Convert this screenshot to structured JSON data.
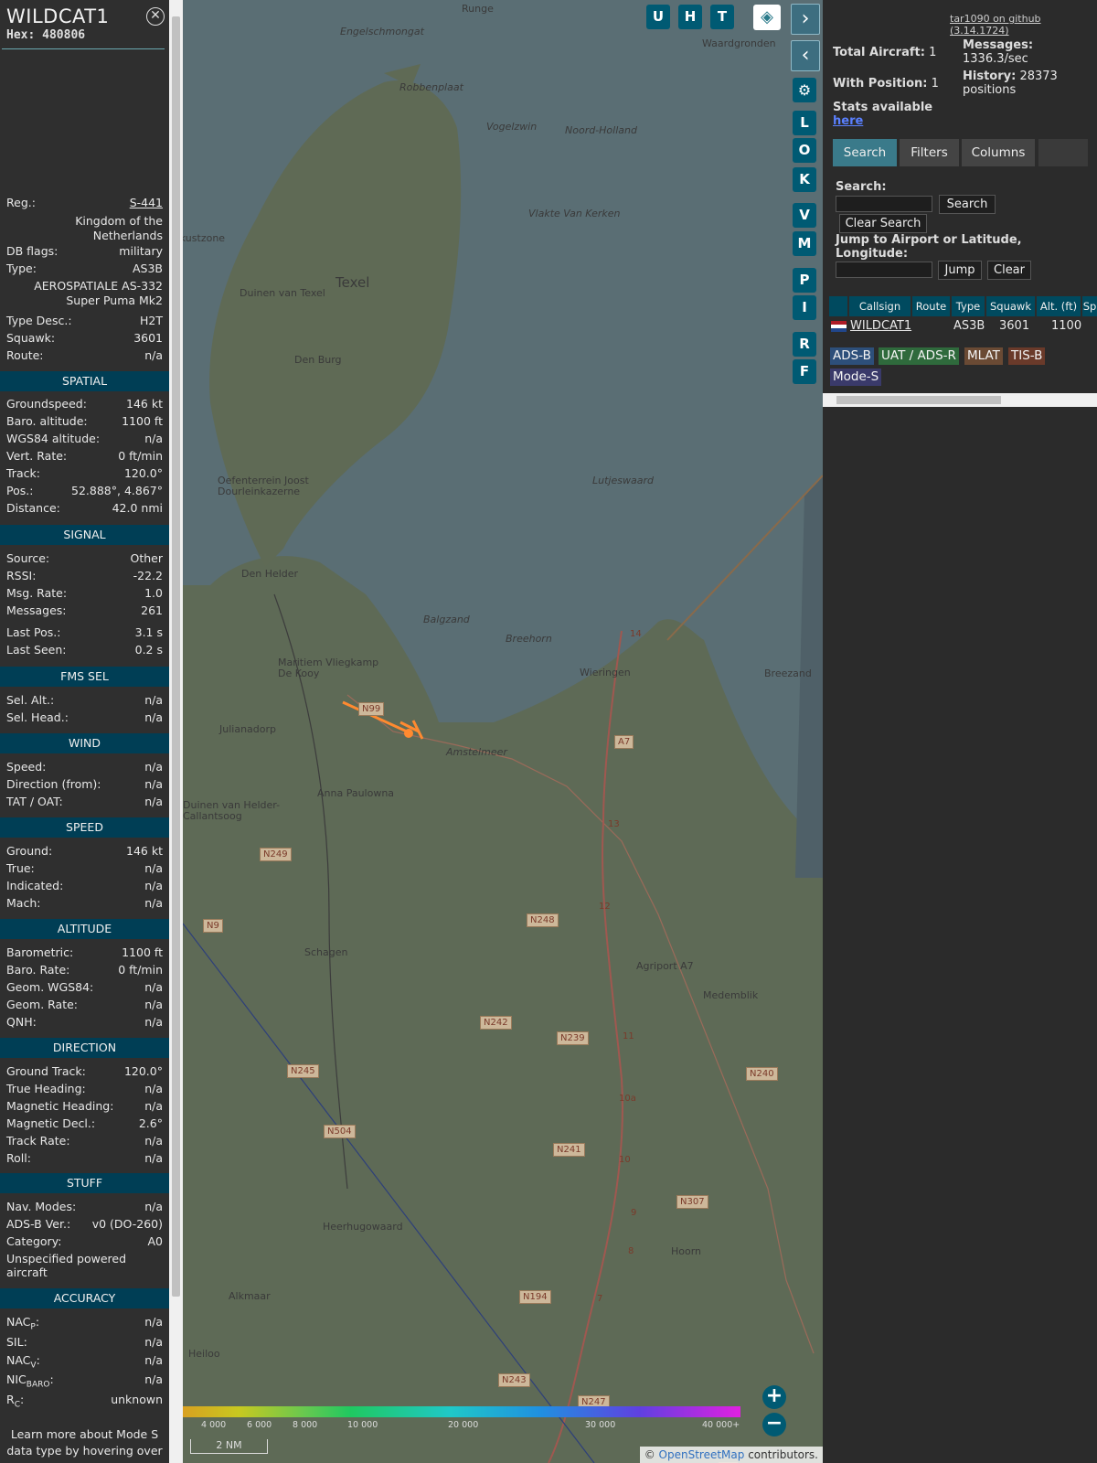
{
  "aircraft": {
    "callsign": "WILDCAT1",
    "hex_label": "Hex:",
    "hex": "480806"
  },
  "details": {
    "reg_label": "Reg.:",
    "reg": "S-441",
    "country_l1": "Kingdom of the",
    "country_l2": "Netherlands",
    "dbflags_label": "DB flags:",
    "dbflags": "military",
    "type_label": "Type:",
    "type": "AS3B",
    "type_name_l1": "AEROSPATIALE AS-332",
    "type_name_l2": "Super Puma Mk2",
    "type_desc_label": "Type Desc.:",
    "type_desc": "H2T",
    "squawk_label": "Squawk:",
    "squawk": "3601",
    "route_label": "Route:",
    "route": "n/a"
  },
  "sections": {
    "spatial": "SPATIAL",
    "signal": "SIGNAL",
    "fms": "FMS SEL",
    "wind": "WIND",
    "speed": "SPEED",
    "altitude": "ALTITUDE",
    "direction": "DIRECTION",
    "stuff": "STUFF",
    "accuracy": "ACCURACY"
  },
  "spatial": [
    [
      "Groundspeed:",
      "146 kt"
    ],
    [
      "Baro. altitude:",
      "1100 ft"
    ],
    [
      "WGS84 altitude:",
      "n/a"
    ],
    [
      "Vert. Rate:",
      "0 ft/min"
    ],
    [
      "Track:",
      "120.0°"
    ],
    [
      "Pos.:",
      "52.888°, 4.867°"
    ],
    [
      "Distance:",
      "42.0 nmi"
    ]
  ],
  "signal": [
    [
      "Source:",
      "Other"
    ],
    [
      "RSSI:",
      "-22.2"
    ],
    [
      "Msg. Rate:",
      "1.0"
    ],
    [
      "Messages:",
      "261"
    ],
    [
      "Last Pos.:",
      "3.1 s"
    ],
    [
      "Last Seen:",
      "0.2 s"
    ]
  ],
  "fms": [
    [
      "Sel. Alt.:",
      "n/a"
    ],
    [
      "Sel. Head.:",
      "n/a"
    ]
  ],
  "wind": [
    [
      "Speed:",
      "n/a"
    ],
    [
      "Direction (from):",
      "n/a"
    ],
    [
      "TAT / OAT:",
      "n/a"
    ]
  ],
  "speed": [
    [
      "Ground:",
      "146 kt"
    ],
    [
      "True:",
      "n/a"
    ],
    [
      "Indicated:",
      "n/a"
    ],
    [
      "Mach:",
      "n/a"
    ]
  ],
  "altitude": [
    [
      "Barometric:",
      "1100 ft"
    ],
    [
      "Baro. Rate:",
      "0 ft/min"
    ],
    [
      "Geom. WGS84:",
      "n/a"
    ],
    [
      "Geom. Rate:",
      "n/a"
    ],
    [
      "QNH:",
      "n/a"
    ]
  ],
  "direction": [
    [
      "Ground Track:",
      "120.0°"
    ],
    [
      "True Heading:",
      "n/a"
    ],
    [
      "Magnetic Heading:",
      "n/a"
    ],
    [
      "Magnetic Decl.:",
      "2.6°"
    ],
    [
      "Track Rate:",
      "n/a"
    ],
    [
      "Roll:",
      "n/a"
    ]
  ],
  "stuff": [
    [
      "Nav. Modes:",
      "n/a"
    ],
    [
      "ADS-B Ver.:",
      "v0 (DO-260)"
    ],
    [
      "Category:",
      "A0"
    ]
  ],
  "category_desc_l1": "Unspecified powered",
  "category_desc_l2": "aircraft",
  "accuracy": {
    "nacp": "n/a",
    "sil": "n/a",
    "nacv": "n/a",
    "nicbaro": "n/a",
    "rc": "unknown",
    "sil_label": "SIL:",
    "nac_p": "NAC",
    "p_sub": "P",
    "nac_v": "NAC",
    "v_sub": "V",
    "nic": "NIC",
    "baro_sub": "BARO",
    "r": "R",
    "c_sub": "C"
  },
  "learn_l1": "Learn more about Mode S",
  "learn_l2": "data type by hovering over",
  "map": {
    "toolbar": [
      "U",
      "H",
      "T"
    ],
    "side_buttons": [
      "L",
      "O",
      "K",
      "V",
      "M",
      "P",
      "I",
      "R",
      "F"
    ],
    "labels": [
      "Runge",
      "Waardgronden",
      "Engelschmongat",
      "Robbenplaat",
      "Vogelzwin",
      "Noord-Holland",
      "Texel",
      "Duinen van Texel",
      "Den Burg",
      "Vlakte Van Kerken",
      "Lutjeswaard",
      "Oefenterrein Joost Dourleinkazerne",
      "Den Helder",
      "Balgzand",
      "Breehorn",
      "Wieringen",
      "Breezand",
      "Maritiem Vliegkamp De Kooy",
      "Julianadorp",
      "Amstelmeer",
      "Anna Paulowna",
      "Duinen van Helder-Callantsoog",
      "Schagen",
      "Agriport A7",
      "Medemblik",
      "Heerhugowaard",
      "Hoorn",
      "Alkmaar",
      "Heiloo",
      "ekustzone"
    ],
    "roads": [
      "N99",
      "A7",
      "N249",
      "N9",
      "N248",
      "N242",
      "N239",
      "N245",
      "N240",
      "N504",
      "N241",
      "N307",
      "N194",
      "N243",
      "N247",
      "A7",
      "14",
      "13",
      "12",
      "11",
      "10a",
      "10",
      "9",
      "8",
      "7"
    ],
    "color_ticks": [
      "4 000",
      "6 000",
      "8 000",
      "10 000",
      "20 000",
      "30 000",
      "40 000+"
    ],
    "scale": "2 NM",
    "attribution_pre": "© ",
    "attribution_link": "OpenStreetMap",
    "attribution_post": " contributors.",
    "zoom_in": "+",
    "zoom_out": "−"
  },
  "stats": {
    "github": "tar1090 on github (3.14.1724)",
    "total_label": "Total Aircraft:",
    "total": "1",
    "pos_label": "With Position:",
    "pos": "1",
    "messages_label": "Messages:",
    "messages": "1336.3/sec",
    "history_label": "History:",
    "history": "28373",
    "history_unit": "positions",
    "stats_label": "Stats available",
    "here": "here"
  },
  "tabs": [
    "Search",
    "Filters",
    "Columns"
  ],
  "search": {
    "label": "Search:",
    "search_btn": "Search",
    "clear_btn": "Clear Search",
    "jump_label_l1": "Jump to Airport or Latitude,",
    "jump_label_l2": "Longitude:",
    "jump_btn": "Jump",
    "clear2_btn": "Clear"
  },
  "table": {
    "headers": [
      "Callsign",
      "Route",
      "Type",
      "Squawk",
      "Alt. (ft)",
      "Sp"
    ],
    "row": {
      "callsign": "WILDCAT1",
      "route": "",
      "type": "AS3B",
      "squawk": "3601",
      "alt": "1100"
    }
  },
  "legend": [
    "ADS-B",
    "UAT / ADS-R",
    "MLAT",
    "TIS-B",
    "Mode-S"
  ]
}
